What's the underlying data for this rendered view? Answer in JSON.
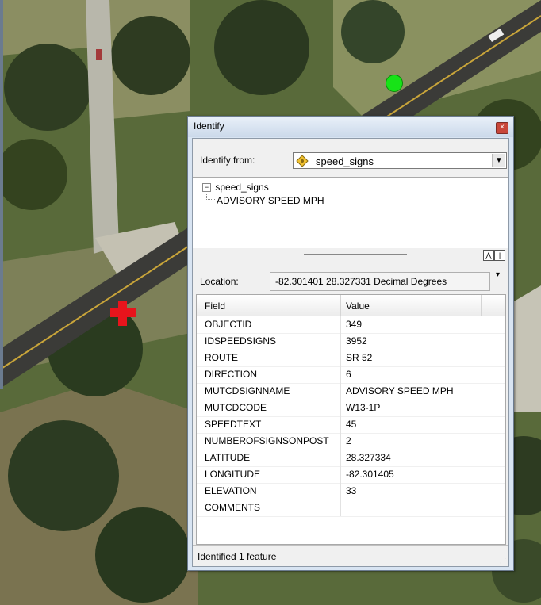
{
  "window": {
    "title": "Identify",
    "close_glyph": "×"
  },
  "identify_from": {
    "label": "Identify from:",
    "selected": "speed_signs",
    "layer_icon": "point-symbol-icon",
    "dropdown_glyph": "▼"
  },
  "tree": {
    "expander_glyph": "−",
    "root": "speed_signs",
    "child": "ADVISORY SPEED MPH"
  },
  "location": {
    "label": "Location:",
    "value": "-82.301401  28.327331 Decimal Degrees",
    "dropdown_glyph": "▾"
  },
  "table": {
    "headers": {
      "field": "Field",
      "value": "Value"
    },
    "rows": [
      {
        "field": "OBJECTID",
        "value": "349"
      },
      {
        "field": "IDSPEEDSIGNS",
        "value": "3952"
      },
      {
        "field": "ROUTE",
        "value": "SR 52"
      },
      {
        "field": "DIRECTION",
        "value": "6"
      },
      {
        "field": "MUTCDSIGNNAME",
        "value": "ADVISORY SPEED MPH"
      },
      {
        "field": "MUTCDCODE",
        "value": "W13-1P"
      },
      {
        "field": "SPEEDTEXT",
        "value": "45"
      },
      {
        "field": "NUMBEROFSIGNSONPOST",
        "value": "2"
      },
      {
        "field": "LATITUDE",
        "value": "28.327334"
      },
      {
        "field": "LONGITUDE",
        "value": "-82.301405"
      },
      {
        "field": "ELEVATION",
        "value": "33"
      },
      {
        "field": "COMMENTS",
        "value": ""
      }
    ]
  },
  "status": {
    "text": "Identified 1 feature"
  },
  "map": {
    "identify_marker_color": "#e8141c",
    "feature_marker_color": "#17e317"
  }
}
